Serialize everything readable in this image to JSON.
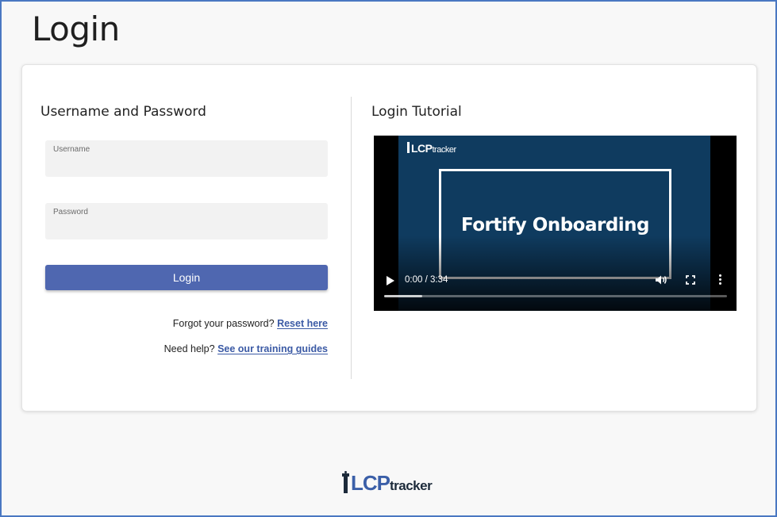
{
  "page": {
    "title": "Login"
  },
  "login_form": {
    "section_title": "Username and Password",
    "username_label": "Username",
    "username_value": "",
    "password_label": "Password",
    "password_value": "",
    "login_button_label": "Login",
    "forgot_text": "Forgot your password?",
    "reset_link": "Reset here",
    "help_text": "Need help?",
    "training_link": "See our training guides"
  },
  "tutorial": {
    "section_title": "Login Tutorial",
    "video_brand": "LCP",
    "video_brand_suffix": "tracker",
    "video_caption": "Fortify Onboarding",
    "time_display": "0:00 / 3:34",
    "buffered_fraction": 0.11,
    "icons": {
      "play": "play-icon",
      "volume": "volume-icon",
      "fullscreen": "fullscreen-icon",
      "menu": "more-vertical-icon"
    }
  },
  "footer": {
    "brand": "LCP",
    "brand_suffix": "tracker"
  },
  "colors": {
    "accent": "#4f67b0",
    "link": "#3b5aa5",
    "frame_border": "#4a78c2",
    "video_background": "#0f3b5f"
  }
}
